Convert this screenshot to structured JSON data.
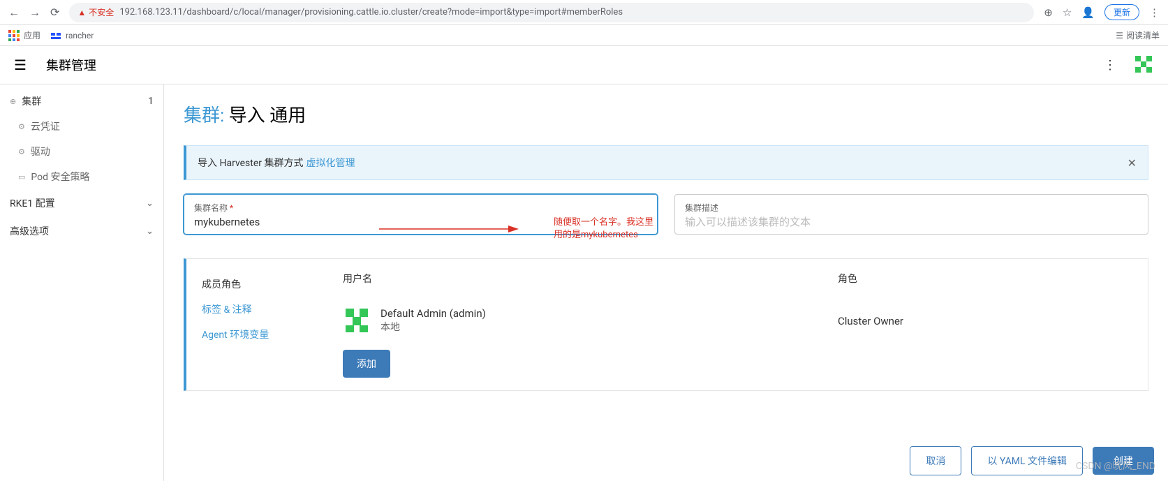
{
  "browser": {
    "not_secure": "不安全",
    "url": "192.168.123.11/dashboard/c/local/manager/provisioning.cattle.io.cluster/create?mode=import&type=import#memberRoles",
    "update": "更新",
    "bookmarks": {
      "apps": "应用",
      "rancher": "rancher",
      "reading_list": "阅读清单"
    }
  },
  "header": {
    "title": "集群管理"
  },
  "sidebar": {
    "clusters": {
      "label": "集群",
      "count": "1"
    },
    "cloud_creds": "云凭证",
    "drivers": "驱动",
    "pod_security": "Pod 安全策略",
    "rke1": "RKE1 配置",
    "advanced": "高级选项"
  },
  "page": {
    "title_pre": "集群:",
    "title_rest": "导入 通用",
    "banner_text": "导入 Harvester 集群方式",
    "banner_link": "虚拟化管理",
    "name_label": "集群名称",
    "name_value": "mykubernetes",
    "desc_label": "集群描述",
    "desc_placeholder": "输入可以描述该集群的文本",
    "annotation_l1": "随便取一个名字。我这里",
    "annotation_l2": "用的是mykubernetes"
  },
  "tabs": {
    "members": "成员角色",
    "labels": "标签 & 注释",
    "agent": "Agent 环境变量"
  },
  "members": {
    "col_user": "用户名",
    "col_role": "角色",
    "user_name": "Default Admin (admin)",
    "user_sub": "本地",
    "role_val": "Cluster Owner",
    "add": "添加"
  },
  "footer": {
    "cancel": "取消",
    "yaml": "以 YAML 文件编辑",
    "create": "创建"
  },
  "watermark": "CSDN @晚风_END"
}
